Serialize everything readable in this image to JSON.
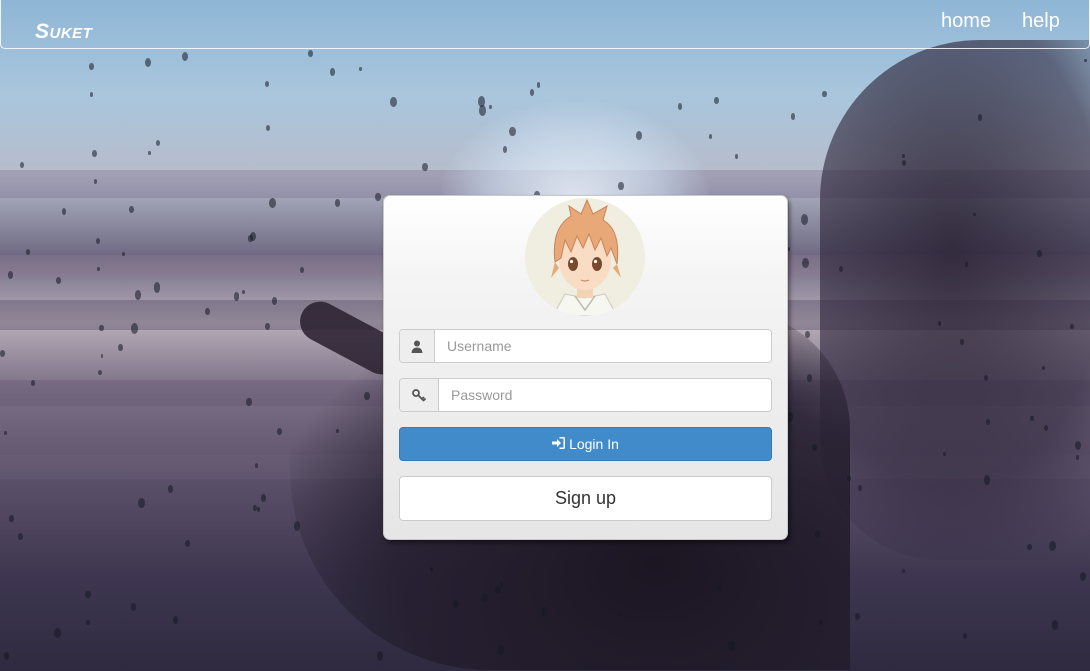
{
  "navbar": {
    "brand": "Suket",
    "links": {
      "home": "home",
      "help": "help"
    }
  },
  "login": {
    "username": {
      "placeholder": "Username",
      "value": "",
      "icon": "user-icon"
    },
    "password": {
      "placeholder": "Password",
      "value": "",
      "icon": "key-icon"
    },
    "login_button": {
      "label": "Login In",
      "icon": "sign-in-icon"
    },
    "signup_button": {
      "label": "Sign up"
    }
  },
  "colors": {
    "primary": "#428bca",
    "card_bg": "#efefef",
    "nav_text": "#ffffff"
  }
}
